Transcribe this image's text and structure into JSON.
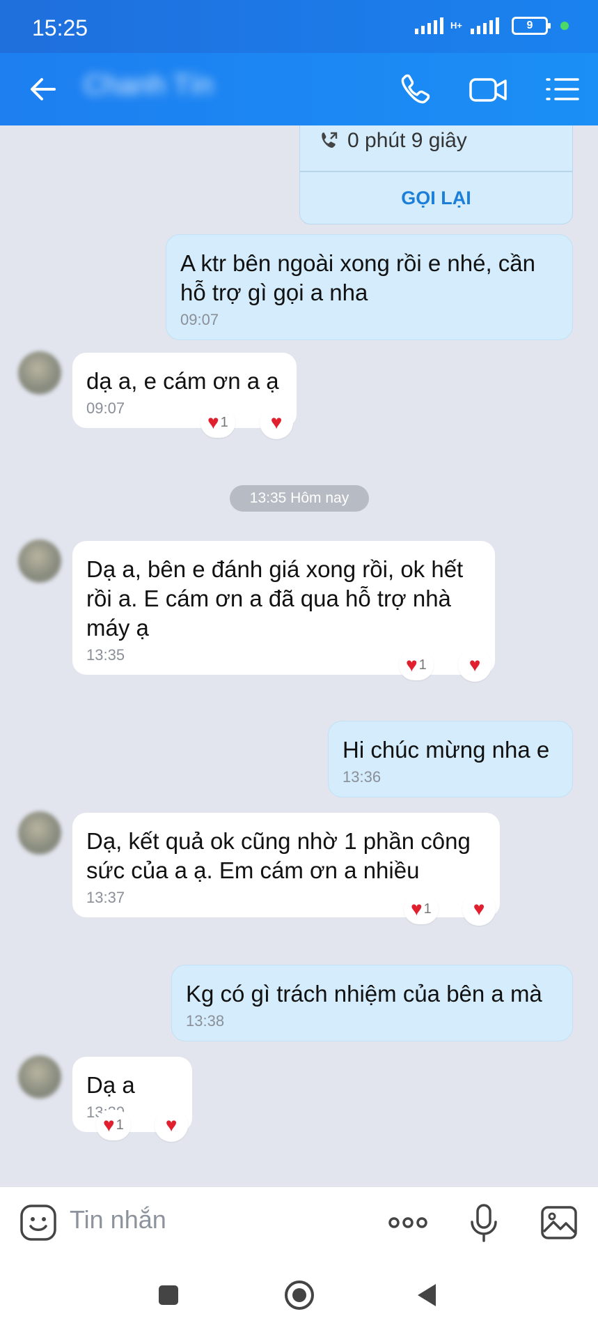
{
  "status_bar": {
    "time": "15:25",
    "network": "H+",
    "battery": "9"
  },
  "header": {
    "contact_name": "Chanh Tín"
  },
  "call_card": {
    "duration": "0 phút 9 giây",
    "callback_label": "GỌI LẠI"
  },
  "messages": [
    {
      "direction": "out",
      "text": "A ktr bên ngoài xong rồi e nhé, cần hỗ trợ gì gọi a nha",
      "time": "09:07"
    },
    {
      "direction": "in",
      "text": "dạ a, e cám ơn a ạ",
      "time": "09:07",
      "reaction_count": "1"
    },
    {
      "direction": "in",
      "text": "Dạ a, bên e đánh giá xong rồi, ok hết rồi a. E cám ơn a đã qua hỗ trợ nhà máy ạ",
      "time": "13:35",
      "reaction_count": "1"
    },
    {
      "direction": "out",
      "text": "Hi chúc mừng nha e",
      "time": "13:36"
    },
    {
      "direction": "in",
      "text": "Dạ, kết quả ok cũng nhờ 1 phần công sức của a ạ. Em cám ơn a nhiều",
      "time": "13:37",
      "reaction_count": "1"
    },
    {
      "direction": "out",
      "text": "Kg có gì trách nhiệm của bên a mà",
      "time": "13:38"
    },
    {
      "direction": "in",
      "text": "Dạ a",
      "time": "13:39",
      "reaction_count": "1"
    }
  ],
  "date_separator": "13:35 Hôm nay",
  "composer": {
    "placeholder": "Tin nhắn"
  },
  "icons": {
    "back": "arrow-left-icon",
    "call": "phone-icon",
    "video": "video-camera-icon",
    "menu": "list-menu-icon",
    "sticker": "smiley-sticker-icon",
    "more": "more-dots-icon",
    "mic": "microphone-icon",
    "gallery": "image-gallery-icon",
    "reaction": "red-heart-icon"
  },
  "colors": {
    "header": "#1b82ef",
    "outgoing_bubble": "#d4ecfb",
    "incoming_bubble": "#ffffff",
    "chat_background": "#e2e5ee",
    "heart": "#e0202e",
    "link": "#1b7fd9"
  }
}
